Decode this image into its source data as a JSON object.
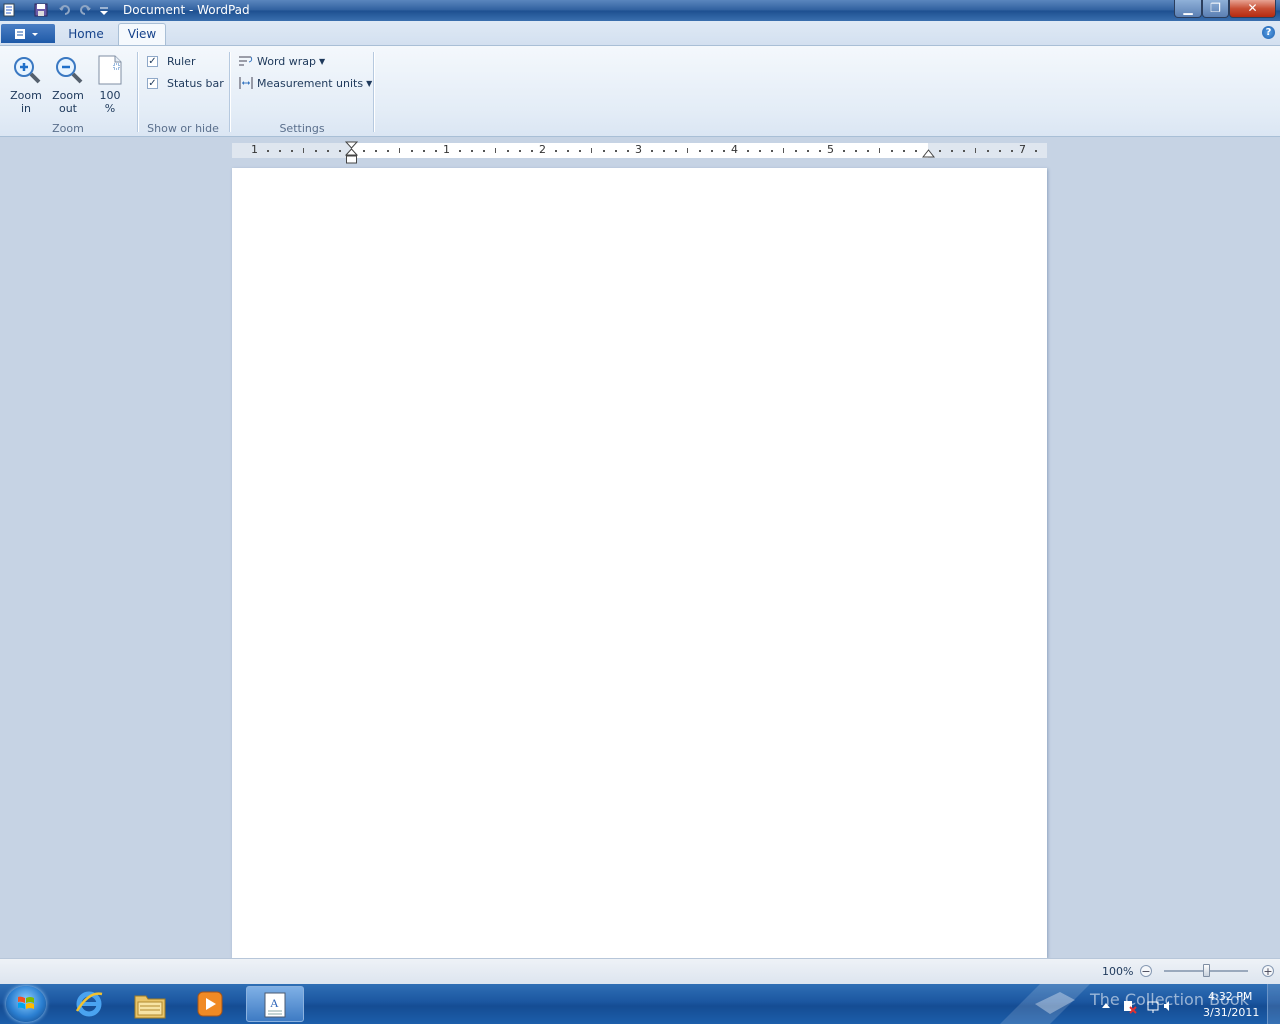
{
  "window": {
    "title": "Document - WordPad"
  },
  "title_buttons": {
    "minimize": "▁",
    "maximize": "❐",
    "close": "✕"
  },
  "tabs": [
    {
      "label": "Home"
    },
    {
      "label": "View"
    }
  ],
  "help": "?",
  "ribbon": {
    "zoom_group": {
      "label": "Zoom",
      "zoom_in": {
        "line1": "Zoom",
        "line2": "in"
      },
      "zoom_out": {
        "line1": "Zoom",
        "line2": "out"
      },
      "hundred": {
        "line1": "100",
        "line2": "%"
      }
    },
    "show_hide_group": {
      "label": "Show or hide",
      "ruler": {
        "label": "Ruler",
        "checked": true
      },
      "status_bar": {
        "label": "Status bar",
        "checked": true
      }
    },
    "settings_group": {
      "label": "Settings",
      "word_wrap": "Word wrap",
      "measurement_units": "Measurement units"
    }
  },
  "ruler": {
    "numbers": [
      "1",
      "1",
      "2",
      "3",
      "4",
      "5",
      "7"
    ]
  },
  "statusbar": {
    "zoom_percent": "100%",
    "zoom_minus": "−",
    "zoom_plus": "+"
  },
  "taskbar": {
    "time": "4:32 PM",
    "date": "3/31/2011",
    "watermark": "The Collection Book"
  }
}
